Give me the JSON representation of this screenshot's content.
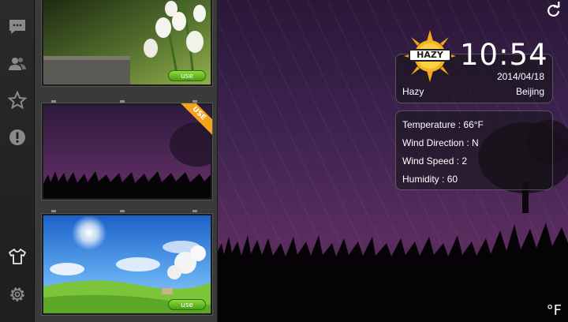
{
  "sidebar": {
    "icons": [
      "chat-icon",
      "contacts-icon",
      "star-icon",
      "alert-icon",
      "shirt-icon",
      "gear-icon"
    ]
  },
  "themes": {
    "cards": [
      {
        "name": "snowdrop-flowers",
        "button_label": "use"
      },
      {
        "name": "purple-night",
        "ribbon_label": "USE"
      },
      {
        "name": "sunny-meadow",
        "button_label": "use"
      }
    ]
  },
  "weather": {
    "badge": "HAZY",
    "time": "10:54",
    "date": "2014/04/18",
    "condition": "Hazy",
    "city": "Beijing",
    "details": [
      {
        "label": "Temperature",
        "value": "66°F"
      },
      {
        "label": "Wind Direction",
        "value": "N"
      },
      {
        "label": "Wind Speed",
        "value": "2"
      },
      {
        "label": "Humidity",
        "value": "60"
      }
    ],
    "unit": "°F"
  },
  "colors": {
    "accent_green": "#6cc22a",
    "ribbon_orange": "#f3a21a",
    "background_purple": "#3d2350"
  }
}
